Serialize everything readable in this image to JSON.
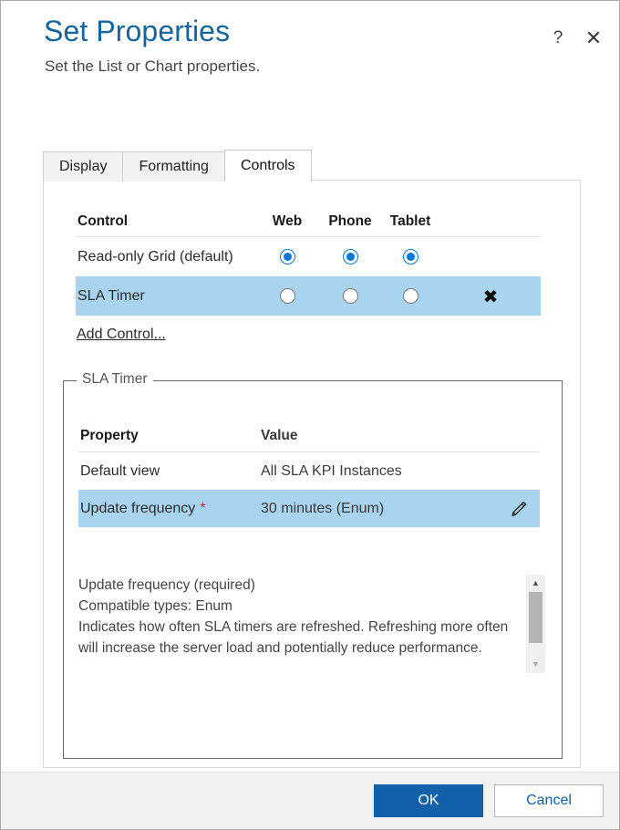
{
  "header": {
    "title": "Set Properties",
    "subtitle": "Set the List or Chart properties.",
    "help_icon": "?",
    "close_icon": "✕"
  },
  "tabs": [
    {
      "label": "Display",
      "active": false
    },
    {
      "label": "Formatting",
      "active": false
    },
    {
      "label": "Controls",
      "active": true
    }
  ],
  "controls_table": {
    "headers": {
      "control": "Control",
      "web": "Web",
      "phone": "Phone",
      "tablet": "Tablet"
    },
    "rows": [
      {
        "name": "Read-only Grid (default)",
        "web": "on",
        "phone": "on",
        "tablet": "on",
        "selected": false,
        "remove_icon": ""
      },
      {
        "name": "SLA Timer",
        "web": "off",
        "phone": "off",
        "tablet": "off",
        "selected": true,
        "remove_icon": "✖"
      }
    ],
    "add_control_link": "Add Control..."
  },
  "fieldset": {
    "legend": "SLA Timer",
    "property_table": {
      "headers": {
        "property": "Property",
        "value": "Value"
      },
      "rows": [
        {
          "property": "Default view",
          "required": "",
          "value": "All SLA KPI Instances",
          "selected": false,
          "edit_icon": ""
        },
        {
          "property": "Update frequency",
          "required": "*",
          "value": "30 minutes (Enum)",
          "selected": true,
          "edit_icon": "pencil-icon"
        }
      ]
    },
    "description": {
      "line1": "Update frequency (required)",
      "line2": "Compatible types: Enum",
      "line3": "Indicates how often SLA timers are refreshed. Refreshing more often will increase the server load and potentially reduce performance.",
      "scroll_up_icon": "▲",
      "scroll_down_icon": "▼"
    }
  },
  "footer": {
    "ok_label": "OK",
    "cancel_label": "Cancel"
  },
  "colors": {
    "title_blue": "#15659f",
    "selection_blue": "#a8d4ef",
    "radio_blue": "#0a76d8",
    "primary_button": "#1261a8",
    "required_red": "#c4342a"
  }
}
